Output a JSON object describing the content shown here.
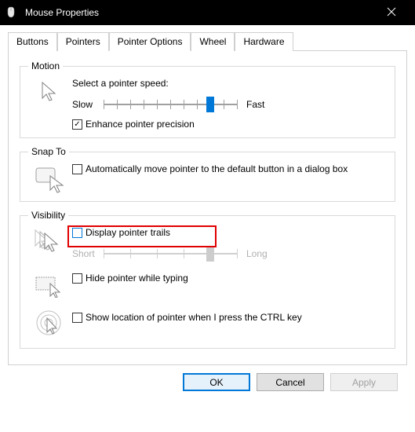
{
  "title": "Mouse Properties",
  "tabs": [
    "Buttons",
    "Pointers",
    "Pointer Options",
    "Wheel",
    "Hardware"
  ],
  "activeTab": 2,
  "motion": {
    "legend": "Motion",
    "label": "Select a pointer speed:",
    "slow": "Slow",
    "fast": "Fast",
    "enhance": "Enhance pointer precision",
    "enhanceChecked": true,
    "sliderValue": 80
  },
  "snapto": {
    "legend": "Snap To",
    "label": "Automatically move pointer to the default button in a dialog box",
    "checked": false
  },
  "visibility": {
    "legend": "Visibility",
    "trails": "Display pointer trails",
    "trailsChecked": false,
    "short": "Short",
    "long": "Long",
    "trailsSlider": 80,
    "hide": "Hide pointer while typing",
    "hideChecked": false,
    "ctrl": "Show location of pointer when I press the CTRL key",
    "ctrlChecked": false
  },
  "buttons": {
    "ok": "OK",
    "cancel": "Cancel",
    "apply": "Apply"
  }
}
